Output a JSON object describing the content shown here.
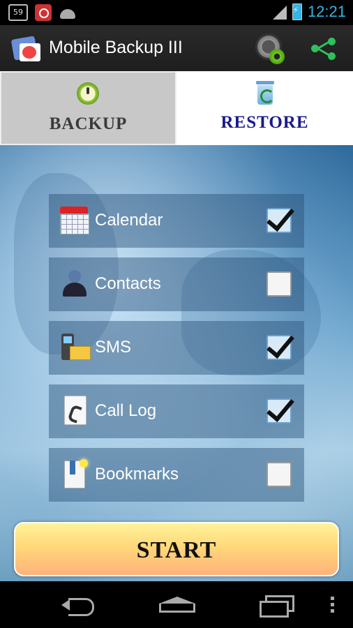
{
  "status_bar": {
    "badge": "59",
    "time": "12:21"
  },
  "action_bar": {
    "title": "Mobile Backup III"
  },
  "tabs": [
    {
      "label": "BACKUP",
      "selected": false
    },
    {
      "label": "RESTORE",
      "selected": true
    }
  ],
  "options": [
    {
      "label": "Calendar",
      "checked": true,
      "icon": "calendar-icon"
    },
    {
      "label": "Contacts",
      "checked": false,
      "icon": "contacts-icon"
    },
    {
      "label": "SMS",
      "checked": true,
      "icon": "sms-icon"
    },
    {
      "label": "Call Log",
      "checked": true,
      "icon": "call-log-icon"
    },
    {
      "label": "Bookmarks",
      "checked": false,
      "icon": "bookmarks-icon"
    }
  ],
  "start_button": {
    "label": "START"
  },
  "colors": {
    "accent": "#33b5e5",
    "restore_text": "#1a1a8c",
    "share": "#2ec25a"
  }
}
